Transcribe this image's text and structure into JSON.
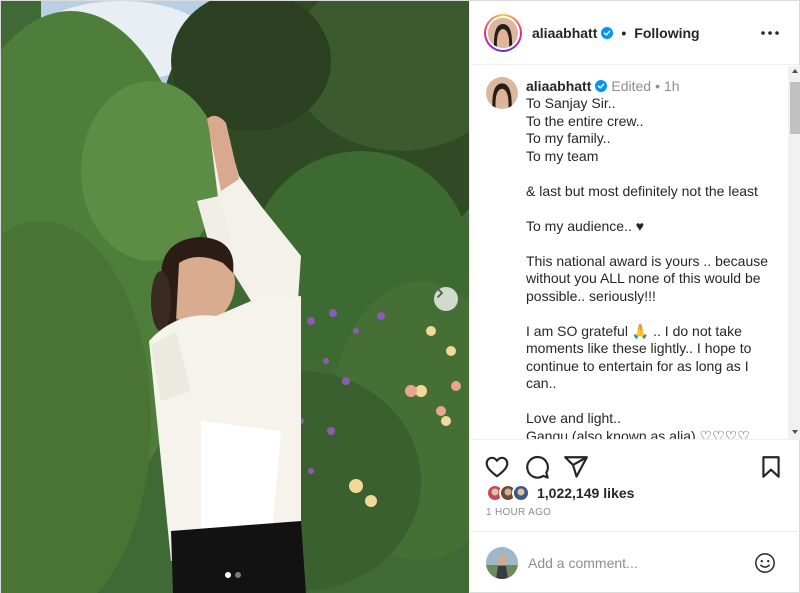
{
  "header": {
    "username": "aliaabhatt",
    "separator": "•",
    "follow_state": "Following",
    "more_icon": "more-horizontal-icon"
  },
  "caption": {
    "username": "aliaabhatt",
    "edited": "Edited",
    "dot": "•",
    "time": "1h",
    "lines": [
      "To Sanjay Sir..",
      "To the entire crew..",
      "To my family..",
      "To my team",
      "",
      "& last but most definitely not the least",
      "",
      "To my audience.. ♥",
      "",
      "This national award is yours .. because without you ALL none of this would be possible.. seriously!!!",
      "",
      "I am SO grateful 🙏 .. I do not take moments like these lightly.. I hope to continue to entertain for as long as I can..",
      "",
      "Love and light..",
      "Gangu (also known as alia) ♡♡♡♡"
    ]
  },
  "actions": {
    "icons": [
      "heart-icon",
      "comment-icon",
      "share-icon",
      "bookmark-icon"
    ]
  },
  "likes": {
    "count": "1,022,149",
    "label": "likes"
  },
  "post_time": "1 hour ago",
  "comment": {
    "placeholder": "Add a comment...",
    "emoji_icon": "smiley-icon"
  },
  "carousel": {
    "current": 1,
    "total": 2,
    "next_icon": "chevron-right-icon"
  },
  "colors": {
    "verified": "#0095f6",
    "text": "#262626",
    "muted": "#8e8e8e"
  }
}
